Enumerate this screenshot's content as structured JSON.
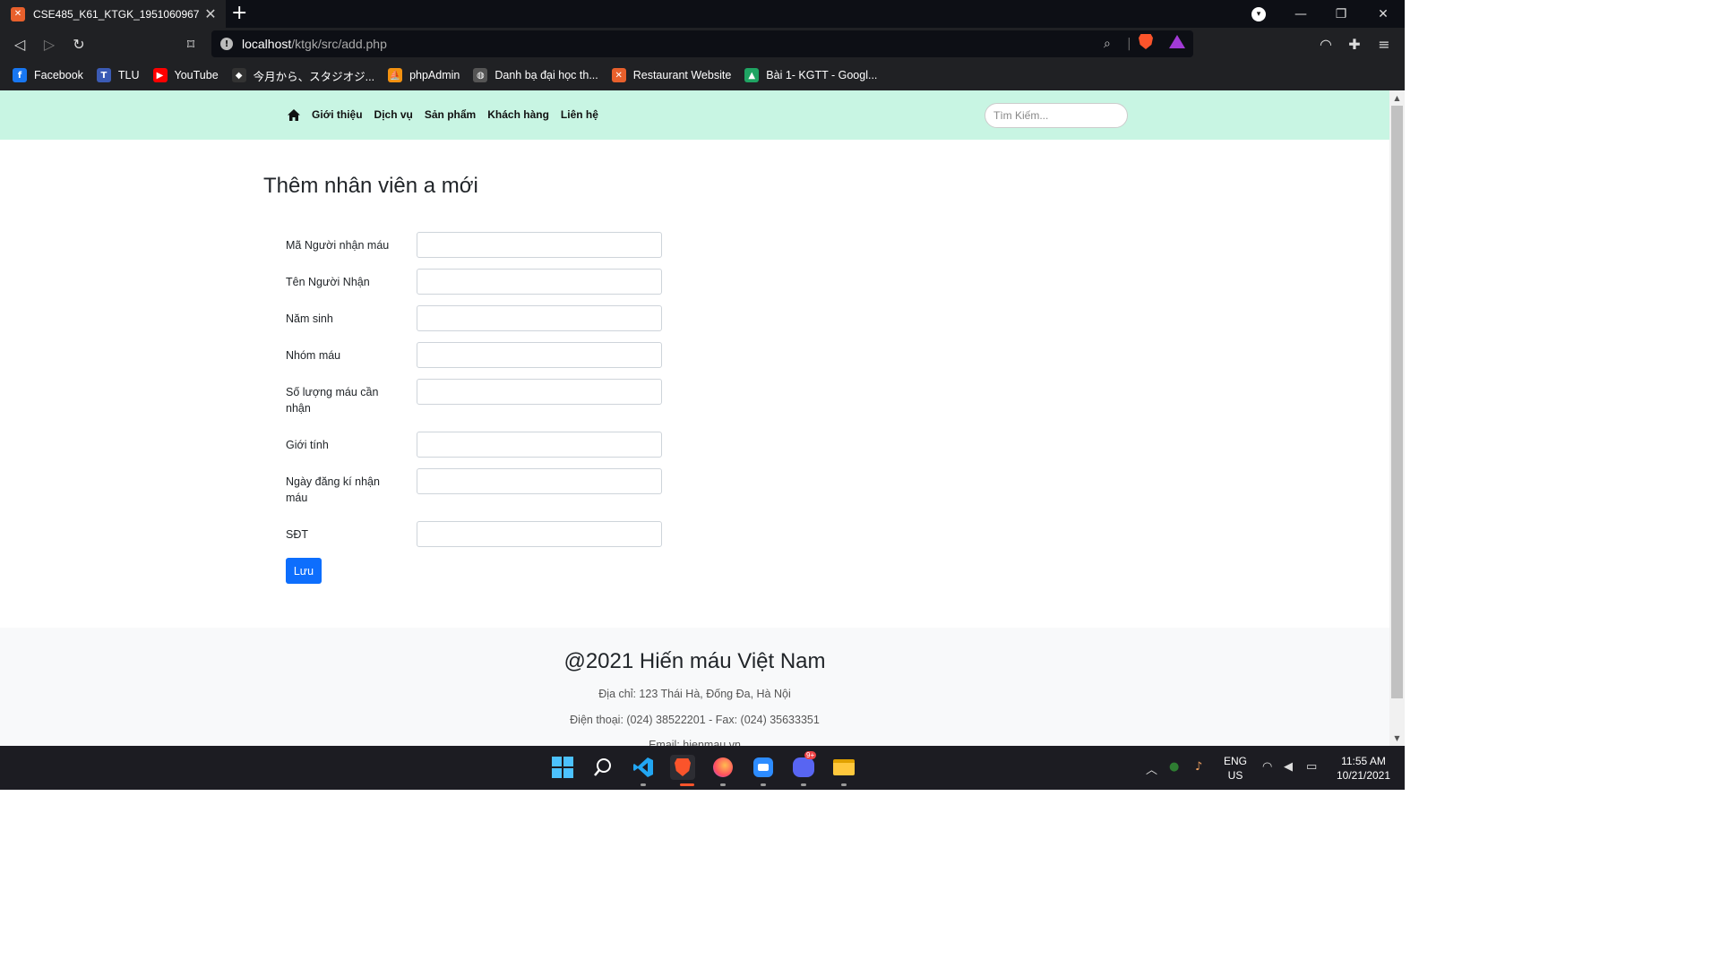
{
  "browser": {
    "tab_title": "CSE485_K61_KTGK_1951060967",
    "tab_close": "✕",
    "new_tab": "+",
    "url_host": "localhost",
    "url_path": "/ktgk/src/add.php",
    "bookmarks": [
      {
        "label": "Facebook",
        "icon": "facebook-icon",
        "color": "#1877f2",
        "glyph": "f"
      },
      {
        "label": "TLU",
        "icon": "tlu-icon",
        "color": "#3b5bb5",
        "glyph": "T"
      },
      {
        "label": "YouTube",
        "icon": "youtube-icon",
        "color": "#ff0000",
        "glyph": "▶"
      },
      {
        "label": "今月から、スタジオジ...",
        "icon": "studio-icon",
        "color": "#333333",
        "glyph": "◆"
      },
      {
        "label": "phpAdmin",
        "icon": "phpadmin-icon",
        "color": "#f29111",
        "glyph": "⛵"
      },
      {
        "label": "Danh bạ đại học th...",
        "icon": "globe-icon",
        "color": "#555555",
        "glyph": "◍"
      },
      {
        "label": "Restaurant Website",
        "icon": "xampp-icon",
        "color": "#e8602c",
        "glyph": "✕"
      },
      {
        "label": "Bài 1- KGTT - Googl...",
        "icon": "drive-icon",
        "color": "#1fa463",
        "glyph": "▲"
      }
    ]
  },
  "navbar": {
    "links": [
      "Giới thiệu",
      "Dịch vụ",
      "Sản phẩm",
      "Khách hàng",
      "Liên hệ"
    ],
    "search_placeholder": "Tìm Kiếm..."
  },
  "form": {
    "title": "Thêm nhân viên a mới",
    "fields": [
      {
        "label": "Mã Người nhận máu",
        "value": ""
      },
      {
        "label": "Tên Người Nhận",
        "value": ""
      },
      {
        "label": "Năm sinh",
        "value": ""
      },
      {
        "label": "Nhóm máu",
        "value": ""
      },
      {
        "label": "Số lượng máu cần nhận",
        "value": ""
      },
      {
        "label": "Giới tính",
        "value": ""
      },
      {
        "label": "Ngày đăng kí nhận máu",
        "value": ""
      },
      {
        "label": "SĐT",
        "value": ""
      }
    ],
    "save_label": "Lưu",
    "save_color": "#0d6efd"
  },
  "footer": {
    "title": "@2021 Hiến máu Việt Nam",
    "address": "Địa chỉ: 123 Thái Hà, Đống Đa, Hà Nội",
    "phone": "Điện thoại: (024) 38522201 - Fax: (024) 35633351",
    "email": "Email: hienmau.vn"
  },
  "taskbar": {
    "lang_line1": "ENG",
    "lang_line2": "US",
    "time": "11:55 AM",
    "date": "10/21/2021",
    "discord_badge": "9+"
  },
  "colors": {
    "navbar_bg": "#c8f5e3",
    "footer_bg": "#f8f9fa",
    "primary": "#0d6efd"
  }
}
